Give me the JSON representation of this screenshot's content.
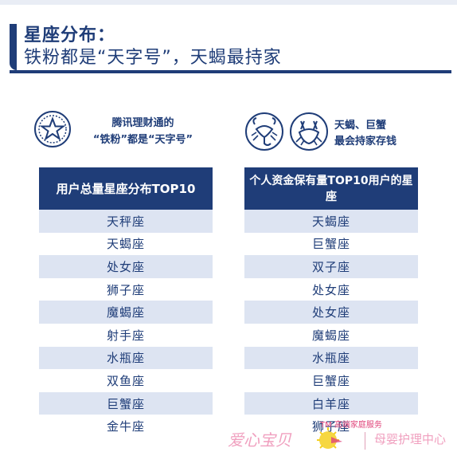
{
  "header": {
    "title": "星座分布：",
    "subtitle": "铁粉都是“天字号”，天蝎最持家"
  },
  "left_panel": {
    "badge_text_line1": "腾讯理财通的",
    "badge_text_line2": "“铁粉”都是“天字号”",
    "table_header": "用户总量星座分布TOP10",
    "rows": [
      "天秤座",
      "天蝎座",
      "处女座",
      "狮子座",
      "魔蝎座",
      "射手座",
      "水瓶座",
      "双鱼座",
      "巨蟹座",
      "金牛座"
    ]
  },
  "right_panel": {
    "badge_text_line1": "天蝎、巨蟹",
    "badge_text_line2": "最会持家存钱",
    "table_header": "个人资金保有量TOP10用户的星座",
    "rows": [
      "天蝎座",
      "巨蟹座",
      "双子座",
      "处女座",
      "处女座",
      "魔蝎座",
      "水瓶座",
      "巨蟹座",
      "白羊座",
      "狮子座"
    ]
  },
  "watermark": {
    "brand": "爱心宝贝",
    "tm": "TM 高端家庭服务",
    "service": "母婴护理中心"
  },
  "colors": {
    "primary": "#1f3d78",
    "row_shade": "#dde4f2",
    "watermark_pink": "#f0a0bf"
  },
  "icons": {
    "left_badge": "star-seal-icon",
    "right_badge_1": "scorpion-icon",
    "right_badge_2": "crab-icon"
  }
}
